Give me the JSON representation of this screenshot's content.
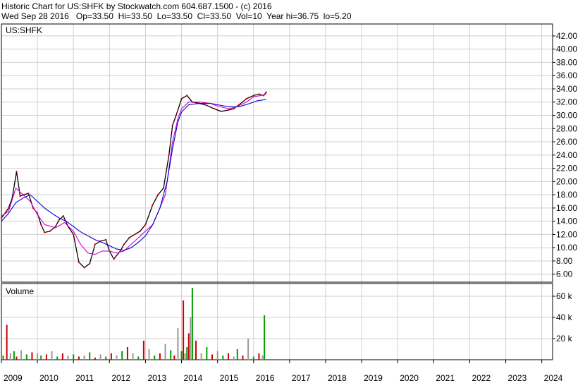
{
  "header": {
    "line1": "Historic Chart for US:SHFK by Stockwatch.com 604.687.1500 - (c) 2016",
    "line2": "Wed Sep 28 2016   Op=33.50  Hi=33.50  Lo=33.50  Cl=33.50  Vol=10  Year hi=36.75  lo=5.20"
  },
  "chart_data": [
    {
      "type": "line",
      "title": "US:SHFK",
      "ylim": [
        4.8,
        43.8
      ],
      "y_ticks": [
        "42.00",
        "40.00",
        "38.00",
        "36.00",
        "34.00",
        "32.00",
        "30.00",
        "28.00",
        "26.00",
        "24.00",
        "22.00",
        "20.00",
        "18.00",
        "16.00",
        "14.00",
        "12.00",
        "10.00",
        "8.00",
        "6.00"
      ],
      "x_ticks": [
        "2009",
        "2010",
        "2011",
        "2012",
        "2013",
        "2014",
        "2015",
        "2016",
        "2017",
        "2018",
        "2019",
        "2020",
        "2021",
        "2022",
        "2023",
        "2024"
      ],
      "xlim": [
        2009.0,
        2024.3
      ],
      "grid": true,
      "series": [
        {
          "color": "#000000",
          "points": [
            [
              2009.0,
              14.5
            ],
            [
              2009.1,
              15.2
            ],
            [
              2009.2,
              16.0
            ],
            [
              2009.3,
              17.5
            ],
            [
              2009.42,
              21.5
            ],
            [
              2009.52,
              17.8
            ],
            [
              2009.62,
              18.0
            ],
            [
              2009.75,
              18.2
            ],
            [
              2009.88,
              16.0
            ],
            [
              2010.0,
              15.2
            ],
            [
              2010.1,
              13.5
            ],
            [
              2010.2,
              12.3
            ],
            [
              2010.35,
              12.5
            ],
            [
              2010.5,
              13.2
            ],
            [
              2010.6,
              14.2
            ],
            [
              2010.72,
              14.8
            ],
            [
              2010.85,
              13.2
            ],
            [
              2011.0,
              12.0
            ],
            [
              2011.15,
              7.8
            ],
            [
              2011.3,
              7.0
            ],
            [
              2011.45,
              7.6
            ],
            [
              2011.6,
              10.5
            ],
            [
              2011.75,
              11.0
            ],
            [
              2011.9,
              11.2
            ],
            [
              2012.0,
              9.5
            ],
            [
              2012.12,
              8.3
            ],
            [
              2012.3,
              9.5
            ],
            [
              2012.4,
              10.5
            ],
            [
              2012.55,
              11.5
            ],
            [
              2012.7,
              12.0
            ],
            [
              2012.85,
              12.5
            ],
            [
              2013.0,
              13.5
            ],
            [
              2013.2,
              16.5
            ],
            [
              2013.35,
              18.0
            ],
            [
              2013.5,
              19.0
            ],
            [
              2013.65,
              24.0
            ],
            [
              2013.75,
              28.5
            ],
            [
              2013.85,
              30.0
            ],
            [
              2014.0,
              32.5
            ],
            [
              2014.15,
              33.0
            ],
            [
              2014.3,
              32.0
            ],
            [
              2014.5,
              31.8
            ],
            [
              2014.7,
              31.5
            ],
            [
              2014.9,
              31.0
            ],
            [
              2015.1,
              30.6
            ],
            [
              2015.3,
              30.8
            ],
            [
              2015.45,
              31.0
            ],
            [
              2015.6,
              31.6
            ],
            [
              2015.8,
              32.5
            ],
            [
              2016.0,
              33.0
            ],
            [
              2016.15,
              33.2
            ],
            [
              2016.28,
              33.0
            ],
            [
              2016.35,
              33.5
            ]
          ]
        },
        {
          "color": "#cc00cc",
          "points": [
            [
              2009.0,
              14.8
            ],
            [
              2009.2,
              15.5
            ],
            [
              2009.4,
              19.0
            ],
            [
              2009.6,
              18.0
            ],
            [
              2009.8,
              17.0
            ],
            [
              2010.0,
              15.0
            ],
            [
              2010.2,
              13.5
            ],
            [
              2010.5,
              13.0
            ],
            [
              2010.75,
              13.8
            ],
            [
              2011.0,
              12.5
            ],
            [
              2011.2,
              10.5
            ],
            [
              2011.4,
              9.2
            ],
            [
              2011.6,
              9.0
            ],
            [
              2011.8,
              9.5
            ],
            [
              2012.0,
              9.5
            ],
            [
              2012.2,
              9.2
            ],
            [
              2012.4,
              9.5
            ],
            [
              2012.6,
              10.5
            ],
            [
              2012.8,
              11.5
            ],
            [
              2013.0,
              12.5
            ],
            [
              2013.2,
              13.5
            ],
            [
              2013.4,
              16.0
            ],
            [
              2013.55,
              18.0
            ],
            [
              2013.65,
              22.0
            ],
            [
              2013.75,
              26.0
            ],
            [
              2013.9,
              29.5
            ],
            [
              2014.0,
              31.0
            ],
            [
              2014.2,
              32.0
            ],
            [
              2014.5,
              32.0
            ],
            [
              2014.8,
              31.8
            ],
            [
              2015.0,
              31.4
            ],
            [
              2015.3,
              31.0
            ],
            [
              2015.5,
              31.2
            ],
            [
              2015.8,
              32.0
            ],
            [
              2016.0,
              32.8
            ],
            [
              2016.2,
              33.0
            ],
            [
              2016.35,
              33.2
            ]
          ]
        },
        {
          "color": "#0000cc",
          "points": [
            [
              2009.0,
              14.0
            ],
            [
              2009.2,
              15.2
            ],
            [
              2009.4,
              16.8
            ],
            [
              2009.6,
              17.5
            ],
            [
              2009.8,
              18.0
            ],
            [
              2010.0,
              17.0
            ],
            [
              2010.2,
              16.0
            ],
            [
              2010.4,
              15.2
            ],
            [
              2010.6,
              14.5
            ],
            [
              2010.8,
              14.0
            ],
            [
              2011.0,
              13.2
            ],
            [
              2011.2,
              12.4
            ],
            [
              2011.4,
              11.8
            ],
            [
              2011.6,
              11.2
            ],
            [
              2011.8,
              10.8
            ],
            [
              2012.0,
              10.3
            ],
            [
              2012.2,
              9.8
            ],
            [
              2012.4,
              9.6
            ],
            [
              2012.6,
              10.0
            ],
            [
              2012.8,
              10.8
            ],
            [
              2013.0,
              11.8
            ],
            [
              2013.2,
              13.5
            ],
            [
              2013.4,
              16.0
            ],
            [
              2013.6,
              20.0
            ],
            [
              2013.75,
              25.0
            ],
            [
              2013.9,
              29.0
            ],
            [
              2014.0,
              30.5
            ],
            [
              2014.2,
              31.6
            ],
            [
              2014.5,
              31.8
            ],
            [
              2014.8,
              31.8
            ],
            [
              2015.0,
              31.6
            ],
            [
              2015.3,
              31.3
            ],
            [
              2015.6,
              31.3
            ],
            [
              2015.9,
              31.8
            ],
            [
              2016.1,
              32.2
            ],
            [
              2016.35,
              32.4
            ]
          ]
        }
      ]
    },
    {
      "type": "bar",
      "title": "Volume",
      "ylim": [
        0,
        72
      ],
      "y_ticks": [
        "60 k",
        "40 k",
        "20 k"
      ],
      "x_ticks": [
        "2009",
        "2010",
        "2011",
        "2012",
        "2013",
        "2014",
        "2015",
        "2016",
        "2017",
        "2018",
        "2019",
        "2020",
        "2021",
        "2022",
        "2023",
        "2024"
      ],
      "xlim": [
        2009.0,
        2024.3
      ],
      "grid": true,
      "x": [
        2009.05,
        2009.15,
        2009.25,
        2009.35,
        2009.42,
        2009.55,
        2009.7,
        2009.85,
        2010.0,
        2010.1,
        2010.25,
        2010.4,
        2010.55,
        2010.7,
        2010.85,
        2011.0,
        2011.15,
        2011.3,
        2011.45,
        2011.6,
        2011.75,
        2011.9,
        2012.05,
        2012.2,
        2012.35,
        2012.5,
        2012.65,
        2012.8,
        2012.95,
        2013.1,
        2013.25,
        2013.4,
        2013.55,
        2013.7,
        2013.8,
        2013.9,
        2014.0,
        2014.05,
        2014.1,
        2014.15,
        2014.2,
        2014.25,
        2014.3,
        2014.4,
        2014.55,
        2014.7,
        2014.85,
        2015.0,
        2015.15,
        2015.3,
        2015.45,
        2015.55,
        2015.7,
        2015.85,
        2016.0,
        2016.15,
        2016.25,
        2016.3
      ],
      "values": [
        4,
        33,
        6,
        8,
        3,
        9,
        5,
        7,
        6,
        4,
        5,
        8,
        3,
        6,
        4,
        5,
        3,
        4,
        7,
        2,
        5,
        3,
        6,
        4,
        8,
        12,
        6,
        3,
        18,
        10,
        4,
        6,
        15,
        9,
        4,
        30,
        8,
        56,
        6,
        12,
        25,
        40,
        68,
        18,
        6,
        12,
        5,
        8,
        4,
        6,
        3,
        10,
        4,
        20,
        3,
        6,
        4,
        42
      ],
      "series": [
        {
          "color": "#00a000"
        },
        {
          "color": "#cc0000"
        },
        {
          "color": "#999999"
        }
      ]
    }
  ]
}
